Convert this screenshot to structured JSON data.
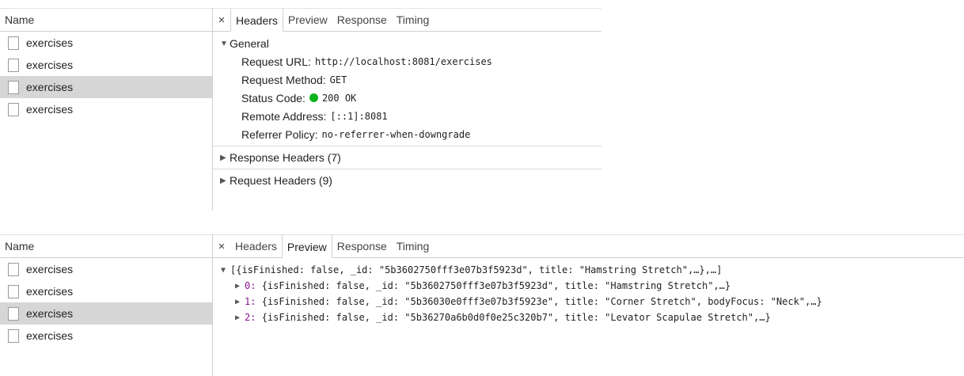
{
  "top_panel": {
    "name_header": "Name",
    "requests": [
      {
        "name": "exercises",
        "selected": false
      },
      {
        "name": "exercises",
        "selected": false
      },
      {
        "name": "exercises",
        "selected": true
      },
      {
        "name": "exercises",
        "selected": false
      }
    ],
    "close": "×",
    "tabs": [
      "Headers",
      "Preview",
      "Response",
      "Timing"
    ],
    "active_tab": "Headers",
    "general": {
      "title": "General",
      "request_url_label": "Request URL:",
      "request_url": "http://localhost:8081/exercises",
      "request_method_label": "Request Method:",
      "request_method": "GET",
      "status_code_label": "Status Code:",
      "status_code": "200 OK",
      "remote_address_label": "Remote Address:",
      "remote_address": "[::1]:8081",
      "referrer_policy_label": "Referrer Policy:",
      "referrer_policy": "no-referrer-when-downgrade"
    },
    "response_headers": "Response Headers (7)",
    "request_headers": "Request Headers (9)"
  },
  "bottom_panel": {
    "name_header": "Name",
    "requests": [
      {
        "name": "exercises",
        "selected": false
      },
      {
        "name": "exercises",
        "selected": false
      },
      {
        "name": "exercises",
        "selected": true
      },
      {
        "name": "exercises",
        "selected": false
      }
    ],
    "close": "×",
    "tabs": [
      "Headers",
      "Preview",
      "Response",
      "Timing"
    ],
    "active_tab": "Preview",
    "json_root": "[{isFinished: false, _id: \"5b3602750fff3e07b3f5923d\", title: \"Hamstring Stretch\",…},…]",
    "json_items": [
      {
        "index": "0",
        "text": "{isFinished: false, _id: \"5b3602750fff3e07b3f5923d\", title: \"Hamstring Stretch\",…}"
      },
      {
        "index": "1",
        "text": "{isFinished: false, _id: \"5b36030e0fff3e07b3f5923e\", title: \"Corner Stretch\", bodyFocus: \"Neck\",…}"
      },
      {
        "index": "2",
        "text": "{isFinished: false, _id: \"5b36270a6b0d0f0e25c320b7\", title: \"Levator Scapulae Stretch\",…}"
      }
    ]
  },
  "colors": {
    "selected_row": "#d6d6d6",
    "status_dot": "#0ab31b",
    "border": "#cfcfcf"
  }
}
